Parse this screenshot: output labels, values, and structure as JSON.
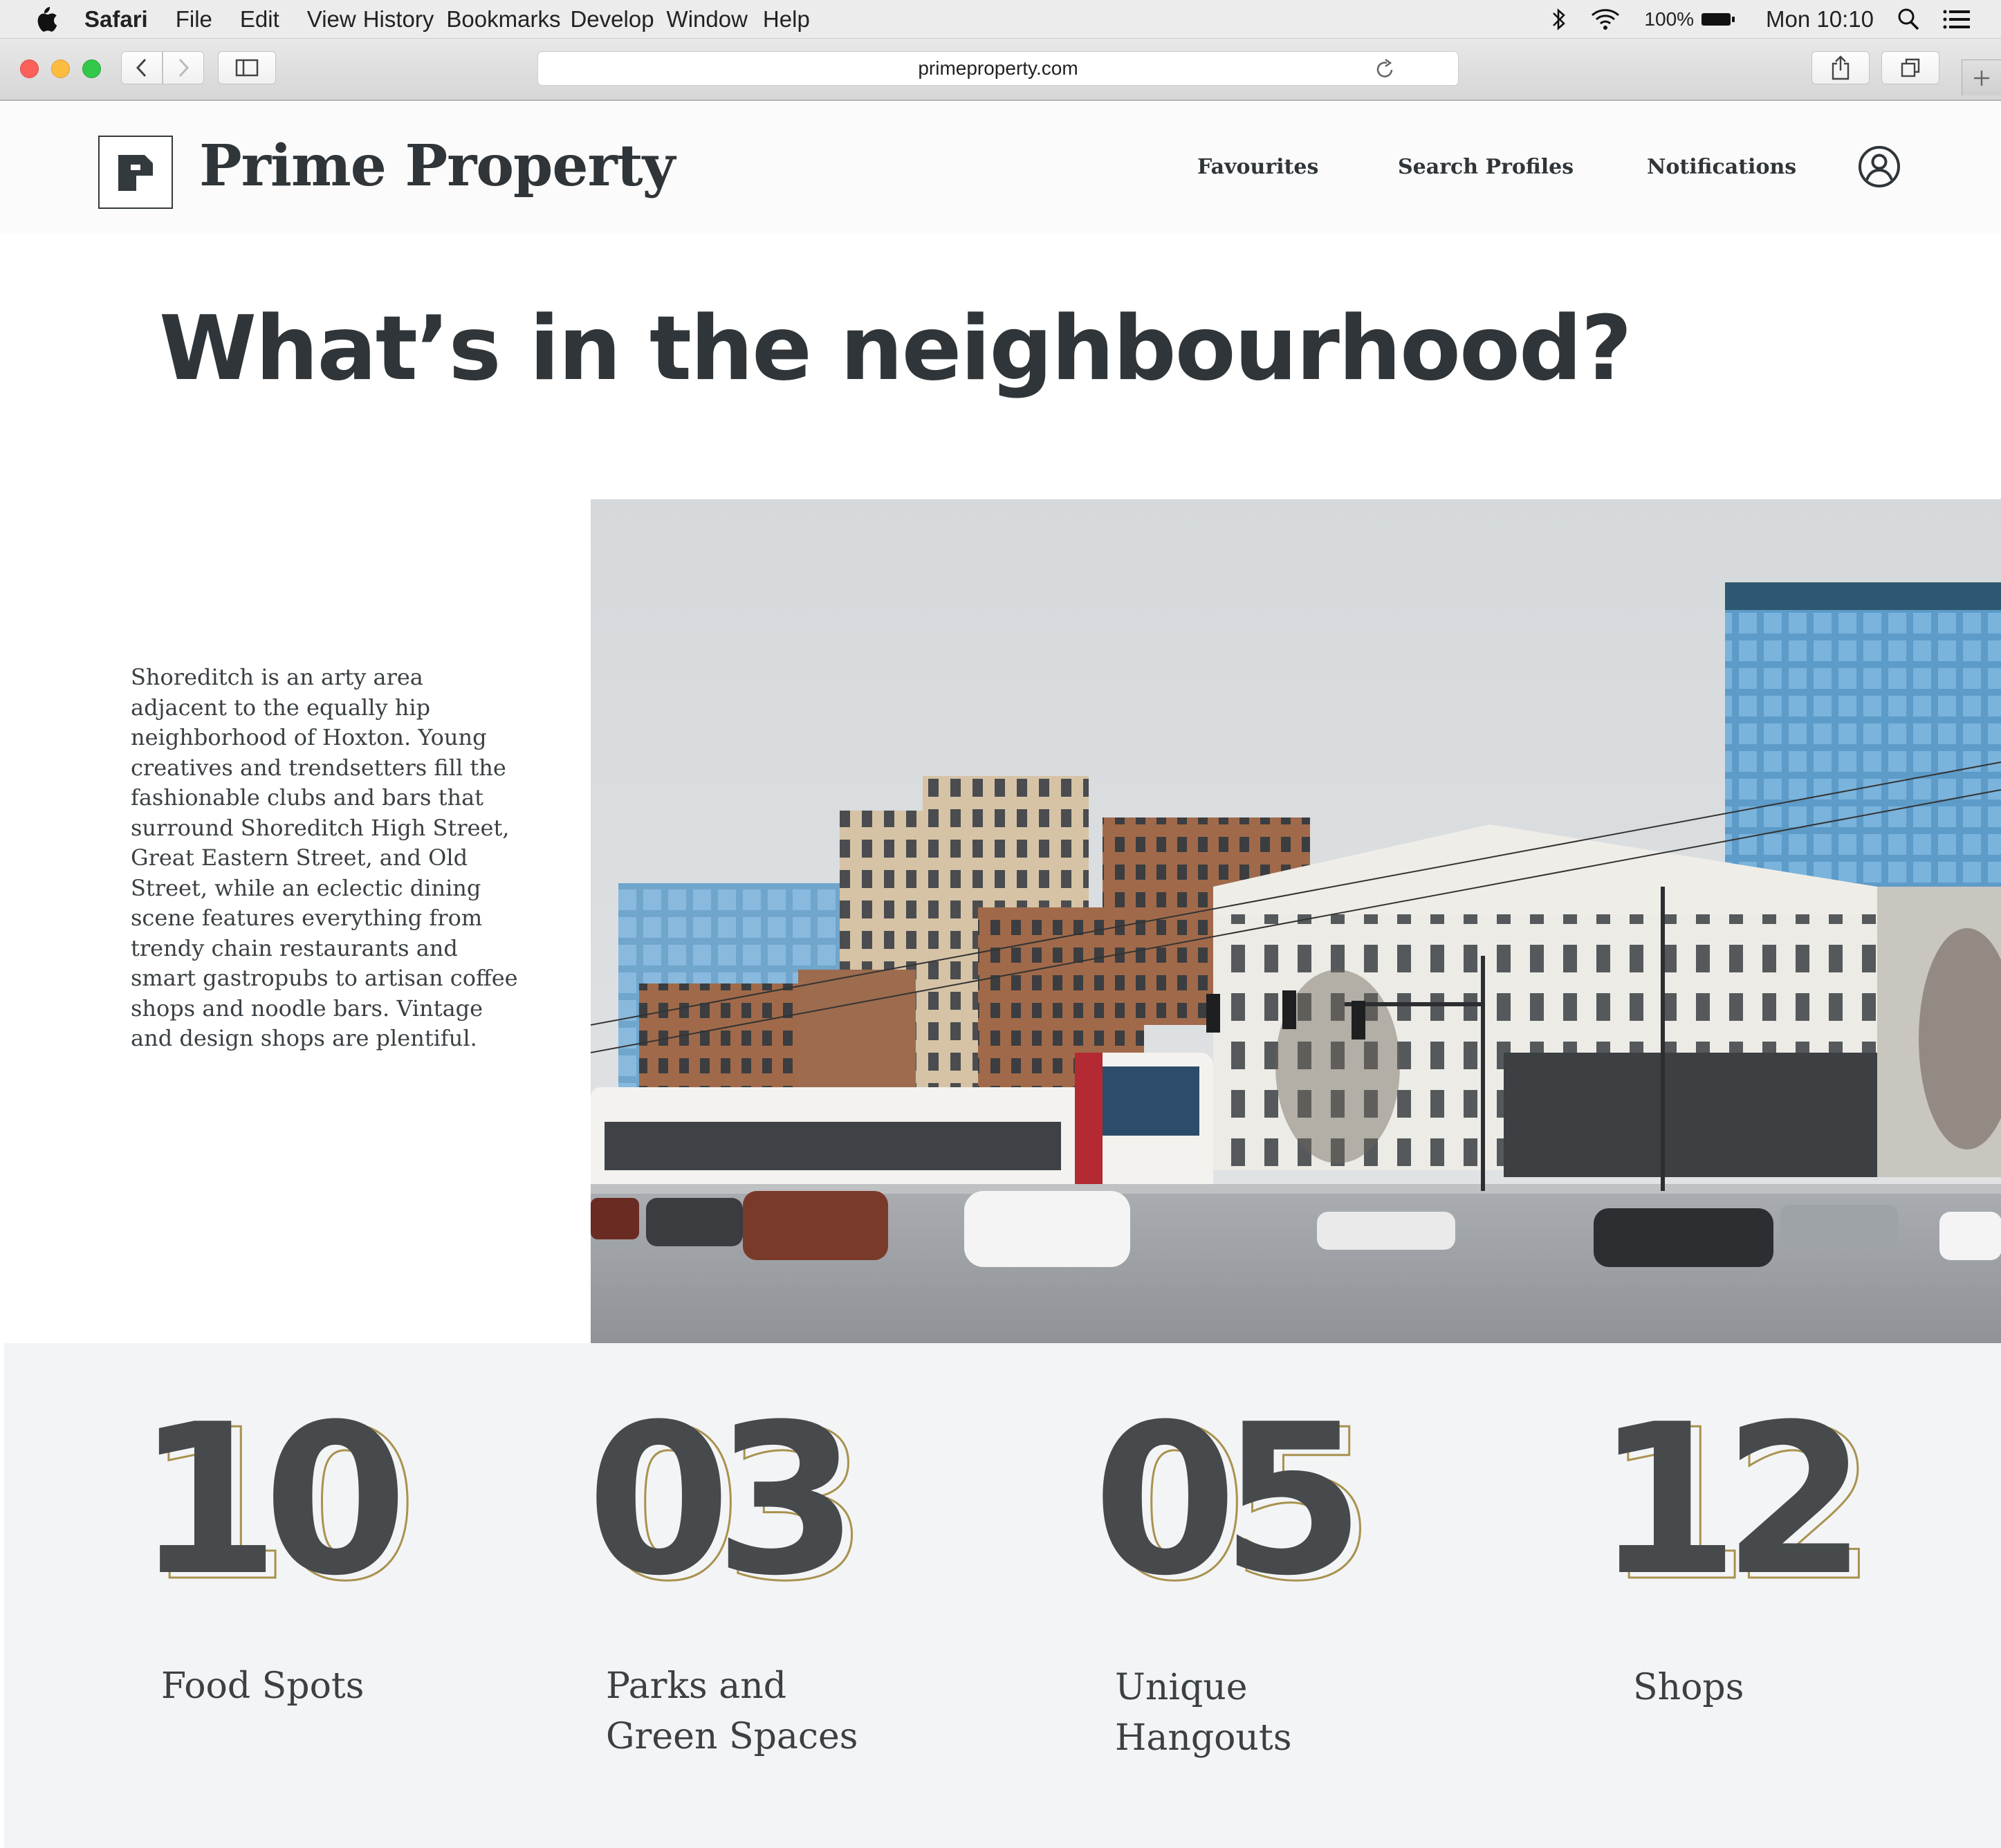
{
  "menubar": {
    "app_name": "Safari",
    "menus": [
      "File",
      "Edit",
      "View",
      "History",
      "Bookmarks",
      "Develop",
      "Window",
      "Help"
    ],
    "battery": "100%",
    "clock": "Mon 10:10",
    "status_icons": [
      "bluetooth-icon",
      "wifi-icon",
      "battery-icon",
      "spotlight-icon",
      "notification-center-icon"
    ]
  },
  "browser": {
    "url": "primeproperty.com"
  },
  "site": {
    "brand": "Prime Property",
    "nav": {
      "favourites": "Favourites",
      "search_profiles": "Search Profiles",
      "notifications": "Notifications"
    },
    "heading": "What’s in the neighbourhood?",
    "description": "Shoreditch is an arty area adjacent to the equally hip neighborhood of Hoxton. Young creatives and trendsetters fill the fashionable clubs and bars that surround Shoreditch High Street, Great Eastern Street, and Old Street, while an eclectic dining scene features everything from trendy chain restaurants and smart gastropubs to artisan coffee shops and noodle bars. Vintage and design shops are plentiful.",
    "stats": [
      {
        "number": "10",
        "label_line1": "Food Spots",
        "label_line2": ""
      },
      {
        "number": "03",
        "label_line1": "Parks and",
        "label_line2": "Green Spaces"
      },
      {
        "number": "05",
        "label_line1": "Unique",
        "label_line2": "Hangouts"
      },
      {
        "number": "12",
        "label_line1": "Shops",
        "label_line2": ""
      }
    ],
    "colors": {
      "text": "#2f3538",
      "number_fill": "#464a4d",
      "number_outline": "#a8924e",
      "stats_background": "#f3f4f6"
    }
  }
}
